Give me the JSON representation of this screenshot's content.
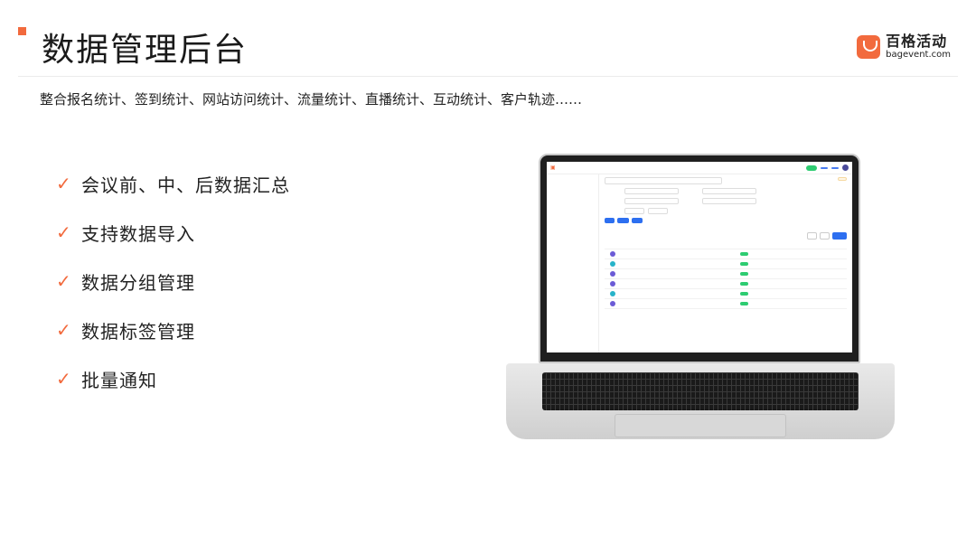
{
  "header": {
    "title": "数据管理后台",
    "logo_cn": "百格活动",
    "logo_en": "bagevent.com"
  },
  "subtitle": "整合报名统计、签到统计、网站访问统计、流量统计、直播统计、互动统计、客户轨迹……",
  "features": [
    {
      "label": "会议前、中、后数据汇总"
    },
    {
      "label": "支持数据导入"
    },
    {
      "label": "数据分组管理"
    },
    {
      "label": "数据标签管理"
    },
    {
      "label": "批量通知"
    }
  ],
  "colors": {
    "accent": "#f26a3d",
    "primary_blue": "#2d6ff0",
    "success": "#2ecc71"
  }
}
